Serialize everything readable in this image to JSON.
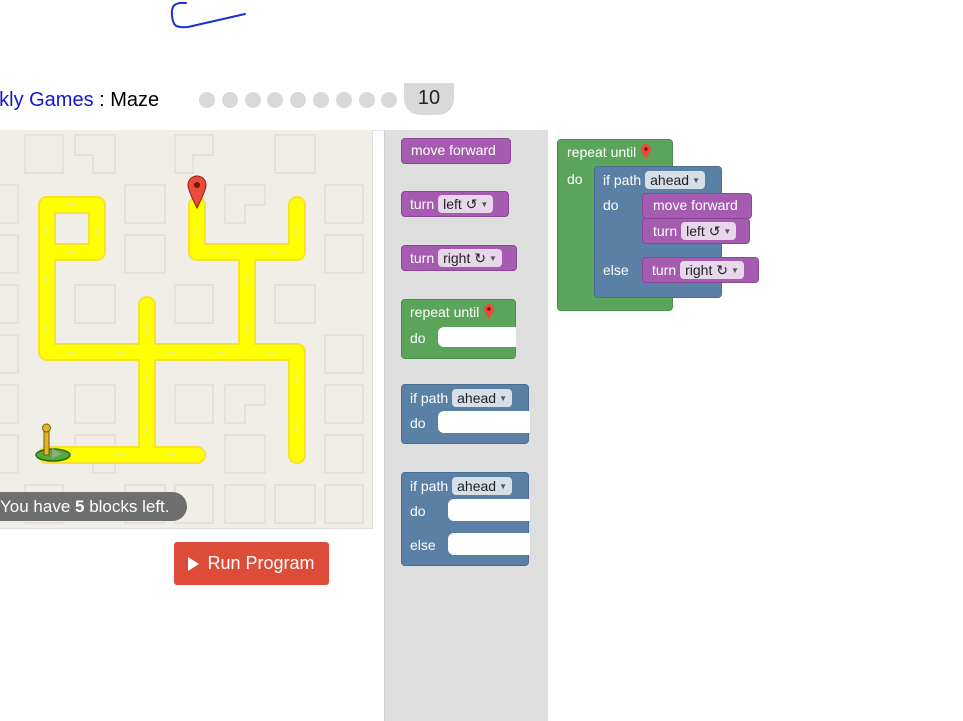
{
  "header": {
    "title_link": "ockly Games",
    "title_sep": " : ",
    "title_game": "Maze",
    "current_level": "10"
  },
  "status": {
    "prefix": "You have ",
    "count": "5",
    "suffix": " blocks left."
  },
  "run_button": {
    "label": "Run Program"
  },
  "toolbox": {
    "move_forward": "move forward",
    "turn_left": {
      "label": "turn",
      "option": "left ↺"
    },
    "turn_right": {
      "label": "turn",
      "option": "right ↻"
    },
    "repeat_until": {
      "label": "repeat until",
      "do": "do"
    },
    "if_path": {
      "label": "if path",
      "option": "ahead",
      "do": "do"
    },
    "if_else": {
      "label": "if path",
      "option": "ahead",
      "do": "do",
      "else": "else"
    }
  },
  "workspace": {
    "repeat_until": "repeat until",
    "do": "do",
    "if_path": "if path",
    "if_option": "ahead",
    "if_do": "do",
    "else": "else",
    "move_forward": "move forward",
    "turn_label": "turn",
    "turn_left_option": "left ↺",
    "turn_right_option": "right ↻"
  },
  "colors": {
    "motion_block": "#a55bb0",
    "loop_block": "#5ba55b",
    "logic_block": "#5b80a5",
    "run_button": "#dd4b39",
    "path": "#ffff00"
  }
}
